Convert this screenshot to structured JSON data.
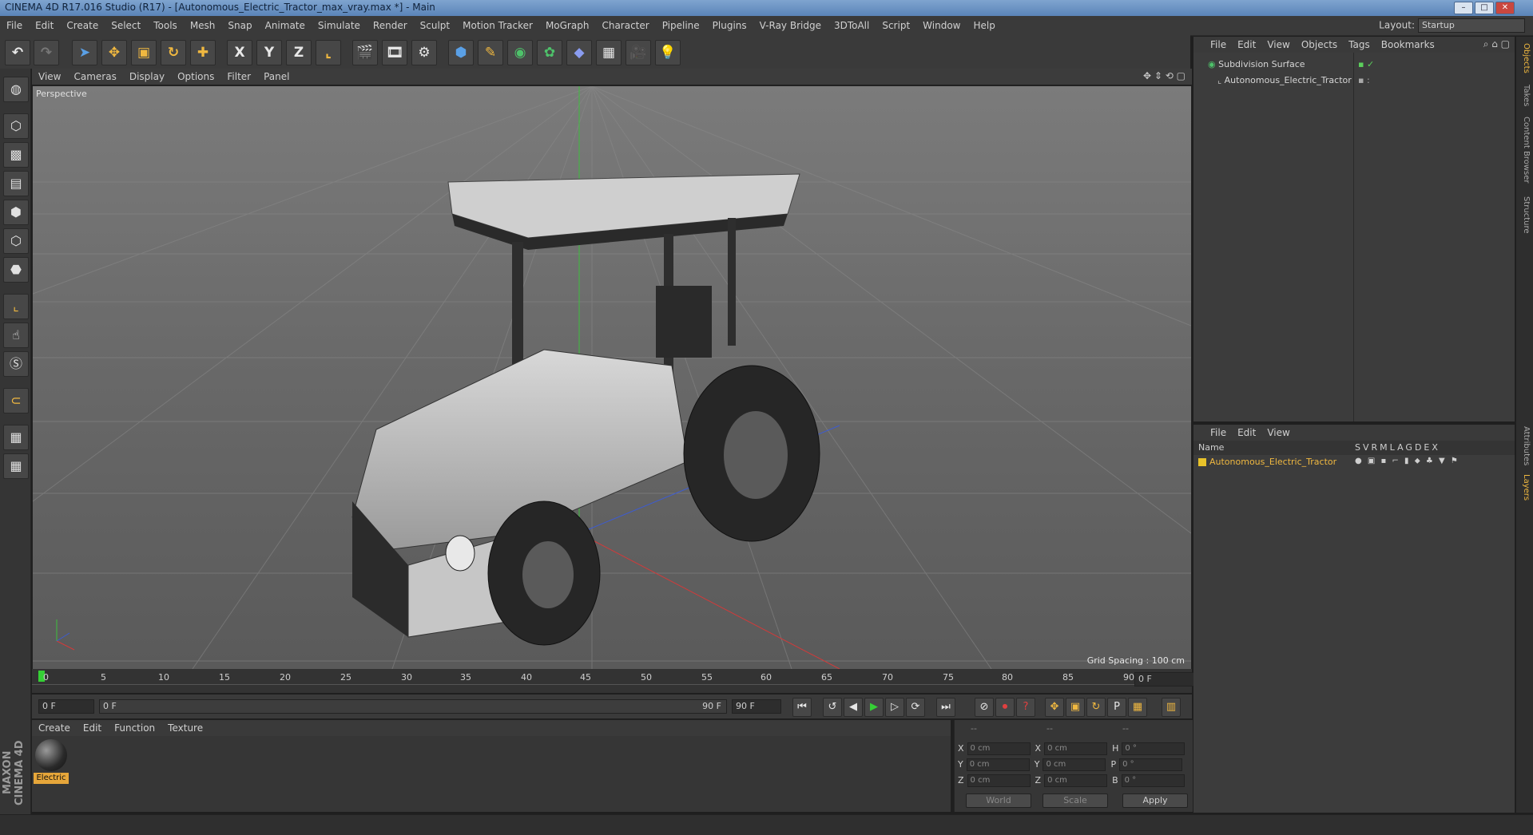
{
  "window": {
    "title": "CINEMA 4D R17.016 Studio (R17) - [Autonomous_Electric_Tractor_max_vray.max *] - Main"
  },
  "menubar": {
    "items": [
      "File",
      "Edit",
      "Create",
      "Select",
      "Tools",
      "Mesh",
      "Snap",
      "Animate",
      "Simulate",
      "Render",
      "Sculpt",
      "Motion Tracker",
      "MoGraph",
      "Character",
      "Pipeline",
      "Plugins",
      "V-Ray Bridge",
      "3DToAll",
      "Script",
      "Window",
      "Help"
    ]
  },
  "layout": {
    "label": "Layout:",
    "value": "Startup"
  },
  "toolbar": {
    "axis_x": "X",
    "axis_y": "Y",
    "axis_z": "Z"
  },
  "viewport": {
    "menu": [
      "View",
      "Cameras",
      "Display",
      "Options",
      "Filter",
      "Panel"
    ],
    "label": "Perspective",
    "grid_spacing": "Grid Spacing : 100 cm"
  },
  "timeline": {
    "ticks": [
      "0",
      "5",
      "10",
      "15",
      "20",
      "25",
      "30",
      "35",
      "40",
      "45",
      "50",
      "55",
      "60",
      "65",
      "70",
      "75",
      "80",
      "85",
      "90"
    ],
    "current": "0 F"
  },
  "transport": {
    "start": "0 F",
    "range_start": "0 F",
    "range_end": "90 F",
    "end": "90 F"
  },
  "material_manager": {
    "menu": [
      "Create",
      "Edit",
      "Function",
      "Texture"
    ],
    "materials": [
      {
        "name": "Electric"
      }
    ]
  },
  "coordinates": {
    "header": [
      "--",
      "--",
      "--"
    ],
    "rows": [
      {
        "pos_label": "X",
        "pos": "0 cm",
        "size_label": "X",
        "size": "0 cm",
        "rot_label": "H",
        "rot": "0 °"
      },
      {
        "pos_label": "Y",
        "pos": "0 cm",
        "size_label": "Y",
        "size": "0 cm",
        "rot_label": "P",
        "rot": "0 °"
      },
      {
        "pos_label": "Z",
        "pos": "0 cm",
        "size_label": "Z",
        "size": "0 cm",
        "rot_label": "B",
        "rot": "0 °"
      }
    ],
    "mode_world": "World",
    "mode_scale": "Scale",
    "apply": "Apply"
  },
  "object_manager": {
    "menu": [
      "File",
      "Edit",
      "View",
      "Objects",
      "Tags",
      "Bookmarks"
    ],
    "objects": [
      {
        "name": "Subdivision Surface"
      },
      {
        "name": "Autonomous_Electric_Tractor"
      }
    ]
  },
  "layer_manager": {
    "menu": [
      "File",
      "Edit",
      "View"
    ],
    "header_name": "Name",
    "columns": [
      "S",
      "V",
      "R",
      "M",
      "L",
      "A",
      "G",
      "D",
      "E",
      "X"
    ],
    "layers": [
      {
        "name": "Autonomous_Electric_Tractor",
        "color": "#e8c22a"
      }
    ]
  },
  "right_tabs": [
    "Objects",
    "Takes",
    "Content Browser",
    "Structure",
    "Attributes",
    "Layers"
  ],
  "branding": {
    "logo_text": "MAXON CINEMA 4D"
  }
}
